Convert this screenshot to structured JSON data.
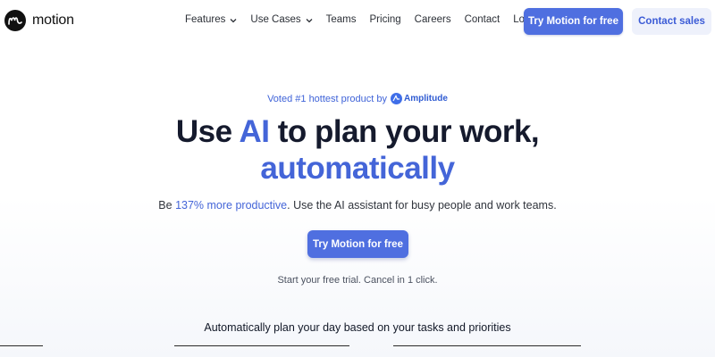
{
  "brand": {
    "name": "motion"
  },
  "nav": {
    "items": [
      {
        "label": "Features",
        "has_dropdown": true
      },
      {
        "label": "Use Cases",
        "has_dropdown": true
      },
      {
        "label": "Teams",
        "has_dropdown": false
      },
      {
        "label": "Pricing",
        "has_dropdown": false
      },
      {
        "label": "Careers",
        "has_dropdown": false
      },
      {
        "label": "Contact",
        "has_dropdown": false
      },
      {
        "label": "Log in",
        "has_dropdown": false
      }
    ],
    "cta_primary": "Try Motion for free",
    "cta_secondary": "Contact sales"
  },
  "hero": {
    "voted_prefix": "Voted #1 hottest product by",
    "voted_brand": "Amplitude",
    "headline_before": "Use ",
    "headline_accent": "AI",
    "headline_after": " to plan your work,",
    "headline_line2": "automatically",
    "subtitle_before": "Be ",
    "subtitle_highlight": "137% more productive",
    "subtitle_after": ". Use the AI assistant for busy people and work teams.",
    "cta": "Try Motion for free",
    "trial_note": "Start your free trial. Cancel in 1 click."
  },
  "section": {
    "heading": "Automatically plan your day based on your tasks and priorities"
  },
  "colors": {
    "accent": "#4465d8",
    "button": "#4f6fe0",
    "secondary_button_bg": "#eef1fb",
    "text": "#151a2d"
  }
}
